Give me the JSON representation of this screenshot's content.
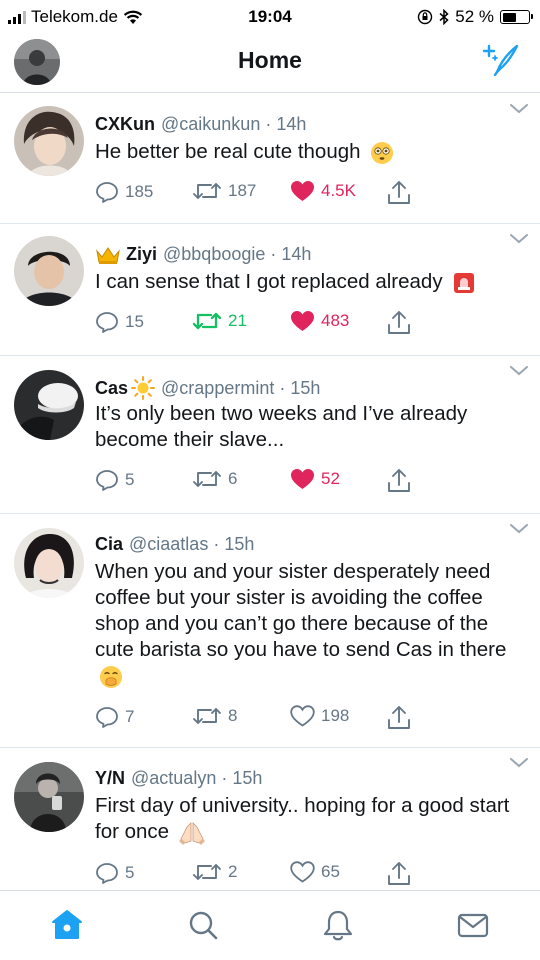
{
  "status_bar": {
    "carrier": "Telekom.de",
    "time": "19:04",
    "battery": "52 %",
    "battery_level": 0.52
  },
  "header": {
    "title": "Home",
    "compose_icon": "feather-sparkle-icon"
  },
  "colors": {
    "accent": "#1da1f2",
    "like": "#e0245e",
    "retweet": "#17bf63",
    "secondary_text": "#657786"
  },
  "tweets": [
    {
      "name": "CXKun",
      "name_emoji": "",
      "handle": "@caikunkun",
      "time": "14h",
      "text": "He better be real cute though",
      "text_emoji": "flushed-face",
      "replies": "185",
      "retweets": "187",
      "likes": "4.5K",
      "liked": true,
      "retweeted": false
    },
    {
      "name": "Ziyi",
      "name_emoji": "crown",
      "handle": "@bbqboogie",
      "time": "14h",
      "text": "I can sense that I got replaced already",
      "text_emoji": "police-light",
      "replies": "15",
      "retweets": "21",
      "likes": "483",
      "liked": true,
      "retweeted": true
    },
    {
      "name": "Cas",
      "name_emoji": "sun",
      "handle": "@crappermint",
      "time": "15h",
      "text": "It’s only been two weeks and I’ve already become their slave...",
      "text_emoji": "",
      "replies": "5",
      "retweets": "6",
      "likes": "52",
      "liked": true,
      "retweeted": false
    },
    {
      "name": "Cia",
      "name_emoji": "",
      "handle": "@ciaatlas",
      "time": "15h",
      "text": "When you and your sister desperately need coffee but your sister is avoiding the coffee shop and you can’t go there because of the cute barista so you have to send Cas in there",
      "text_emoji": "hand-over-mouth-face",
      "replies": "7",
      "retweets": "8",
      "likes": "198",
      "liked": false,
      "retweeted": false
    },
    {
      "name": "Y/N",
      "name_emoji": "",
      "handle": "@actualyn",
      "time": "15h",
      "text": "First day of university.. hoping for a good start for once",
      "text_emoji": "folded-hands",
      "replies": "5",
      "retweets": "2",
      "likes": "65",
      "liked": false,
      "retweeted": false
    }
  ],
  "tab_bar": {
    "items": [
      "home-icon",
      "search-icon",
      "notifications-icon",
      "messages-icon"
    ],
    "active": "home-icon"
  }
}
